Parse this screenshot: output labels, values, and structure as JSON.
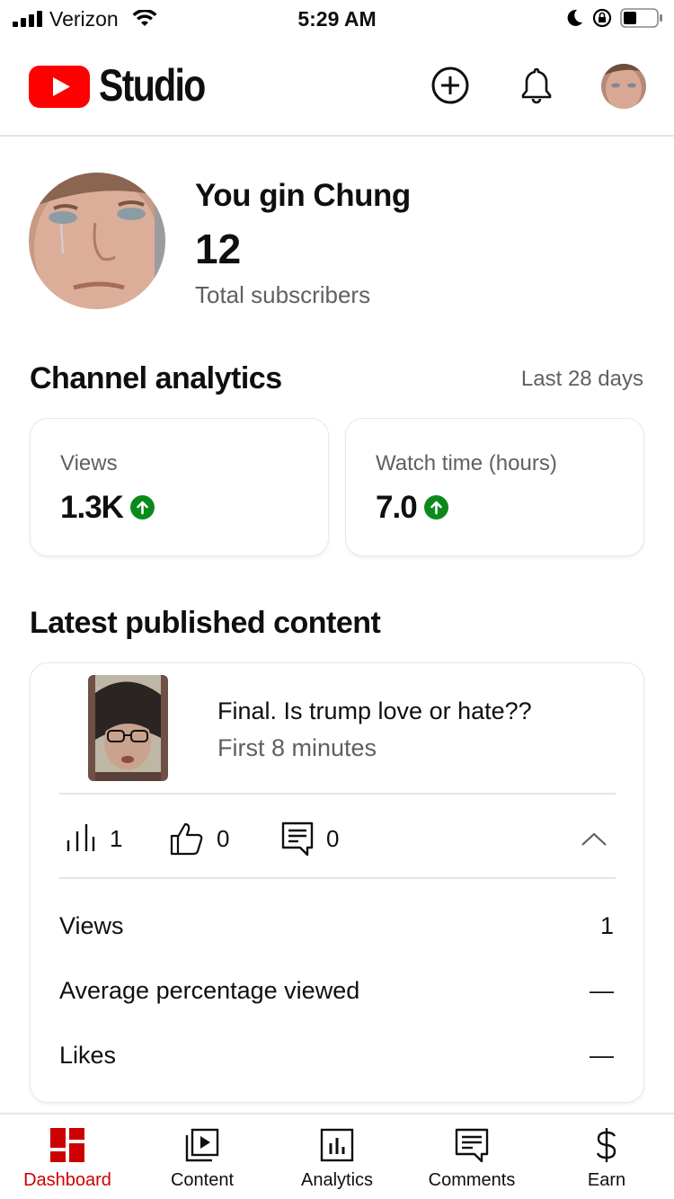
{
  "status_bar": {
    "carrier": "Verizon",
    "time": "5:29 AM",
    "icons": [
      "cellular-signal-icon",
      "wifi-icon",
      "moon-icon",
      "rotation-lock-icon",
      "battery-icon"
    ]
  },
  "app_bar": {
    "title": "Studio",
    "icons": [
      "youtube-logo-icon",
      "create-icon",
      "bell-icon",
      "avatar"
    ]
  },
  "channel": {
    "name": "You gin Chung",
    "subscriber_count": "12",
    "subscriber_label": "Total subscribers"
  },
  "analytics": {
    "title": "Channel analytics",
    "range": "Last 28 days",
    "cards": [
      {
        "label": "Views",
        "value": "1.3K",
        "trend_icon": "arrow-up-icon"
      },
      {
        "label": "Watch time (hours)",
        "value": "7.0",
        "trend_icon": "arrow-up-icon"
      }
    ]
  },
  "latest_content": {
    "title": "Latest published content",
    "video_title": "Final. Is trump love or hate??",
    "video_subtitle": "First 8 minutes",
    "stats": {
      "views": "1",
      "likes": "0",
      "comments": "0"
    },
    "details": [
      {
        "label": "Views",
        "value": "1"
      },
      {
        "label": "Average percentage viewed",
        "value": "—"
      },
      {
        "label": "Likes",
        "value": "—"
      }
    ]
  },
  "bottom_nav": {
    "active": "Dashboard",
    "items": [
      {
        "label": "Dashboard",
        "icon": "dashboard-icon"
      },
      {
        "label": "Content",
        "icon": "content-icon"
      },
      {
        "label": "Analytics",
        "icon": "analytics-icon"
      },
      {
        "label": "Comments",
        "icon": "comments-icon"
      },
      {
        "label": "Earn",
        "icon": "dollar-icon"
      }
    ]
  },
  "colors": {
    "brand_red": "#ff0000",
    "active_red": "#cc0000",
    "trend_green": "#0b8a1c",
    "secondary_text": "#606060"
  }
}
